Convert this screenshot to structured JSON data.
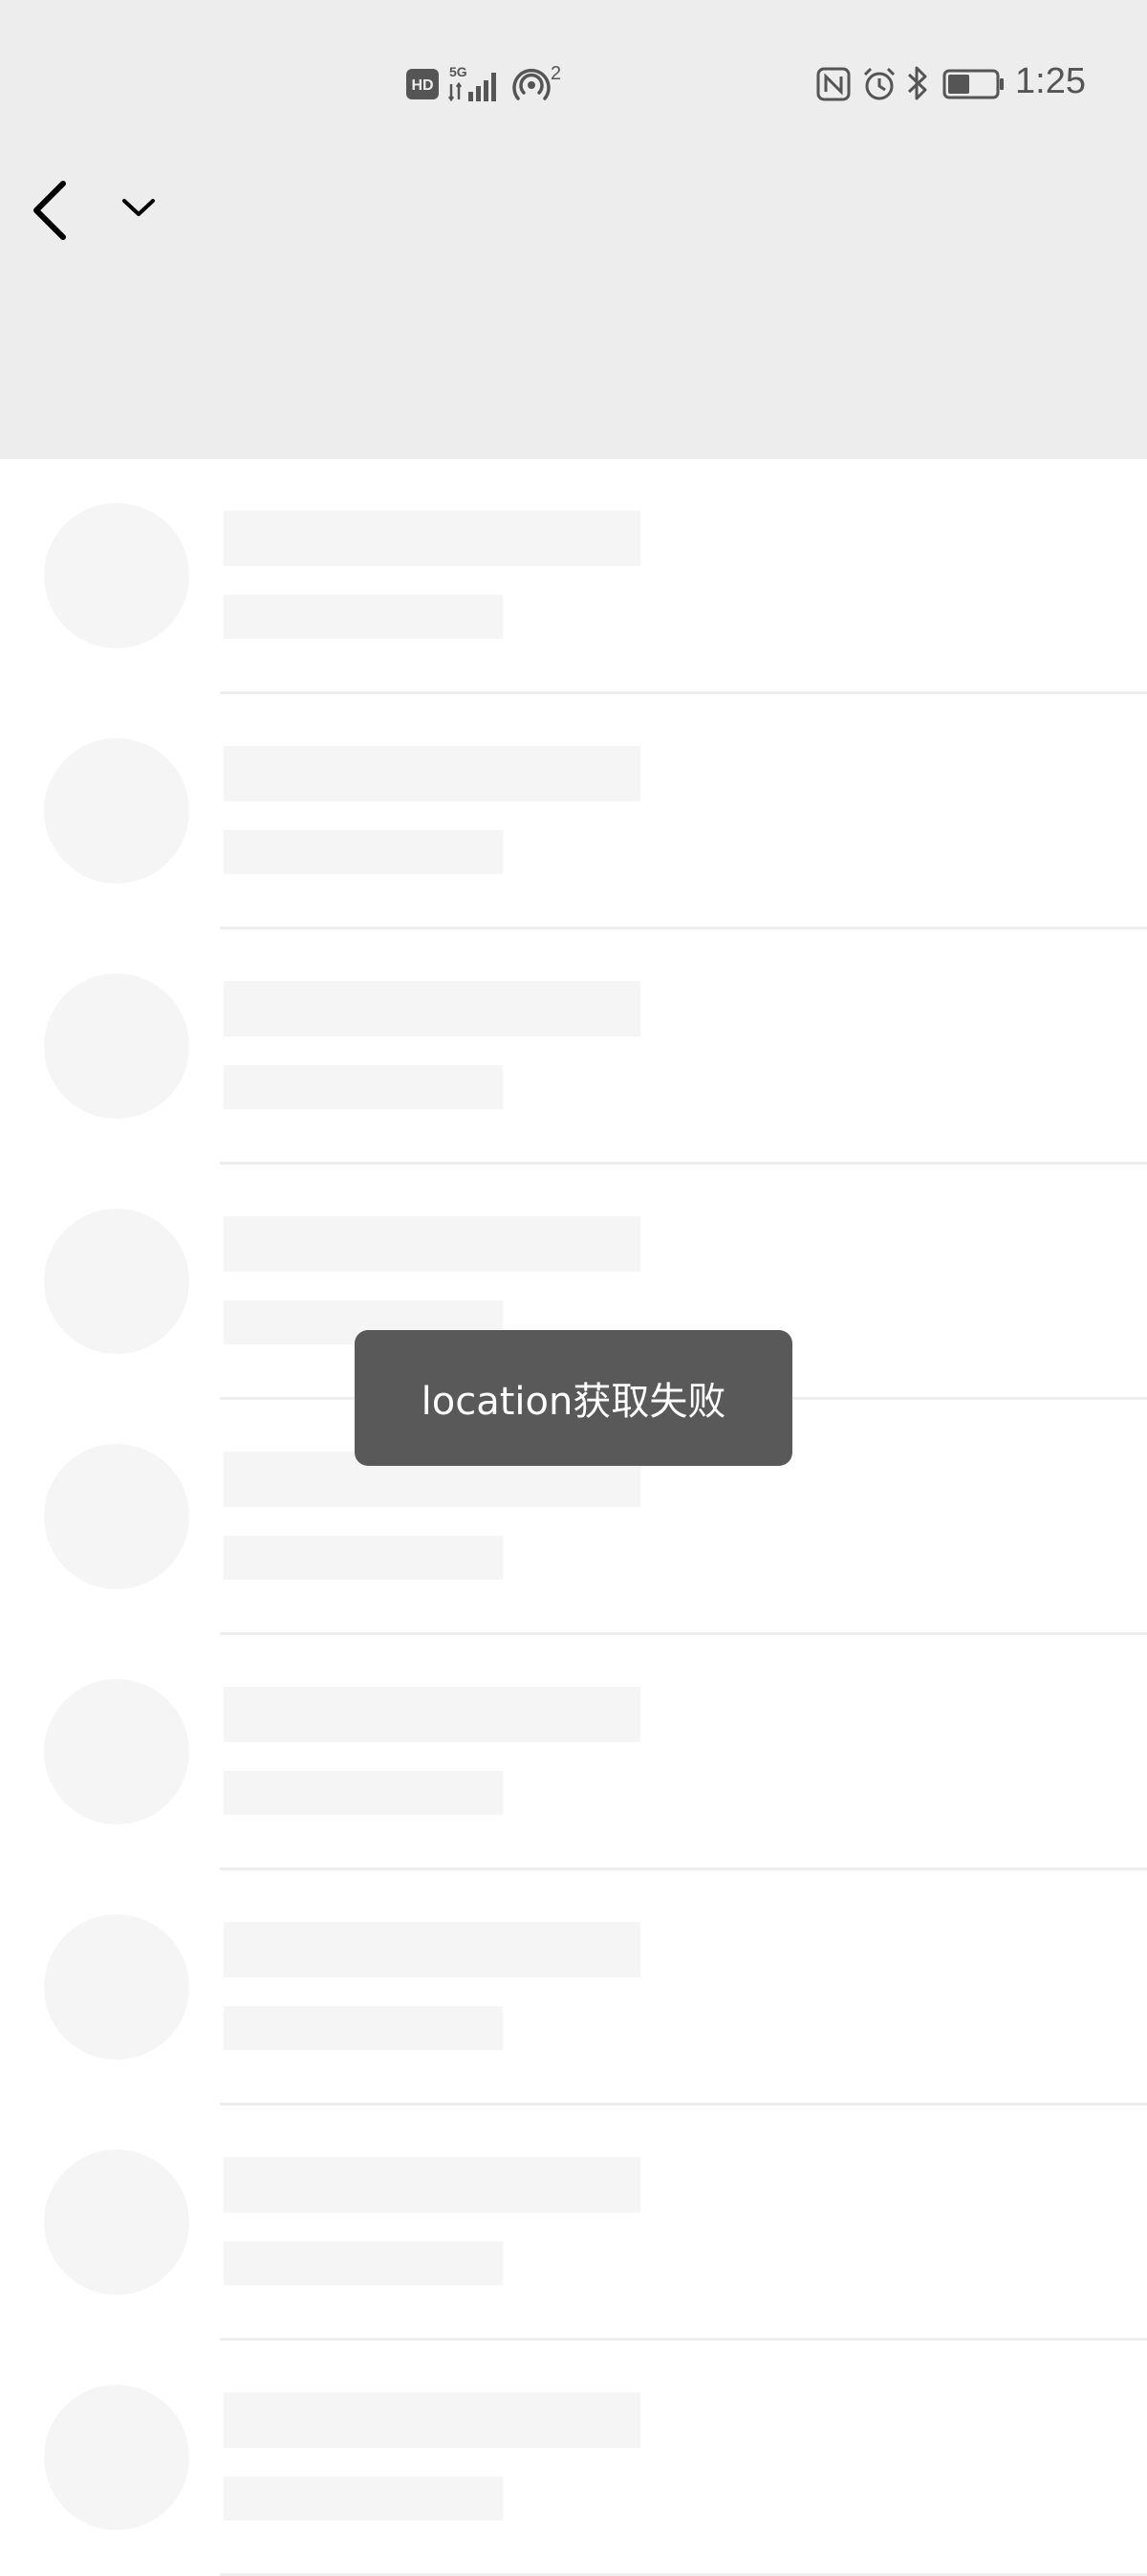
{
  "status_bar": {
    "time": "1:25",
    "network_type": "5G",
    "hd_label": "HD",
    "hotspot_count": "2",
    "icons": [
      "hd-icon",
      "signal-5g-icon",
      "hotspot-icon",
      "nfc-icon",
      "alarm-icon",
      "bluetooth-icon",
      "battery-icon"
    ],
    "battery_level": 0.45
  },
  "nav": {
    "back_icon": "chevron-left-icon",
    "dropdown_icon": "chevron-down-icon"
  },
  "toast": {
    "message": "location获取失败"
  },
  "skeleton_rows": 9,
  "colors": {
    "header_bg": "#ededed",
    "skeleton": "#f5f5f5",
    "toast_bg": "#595959",
    "divider": "#eeeeee"
  }
}
